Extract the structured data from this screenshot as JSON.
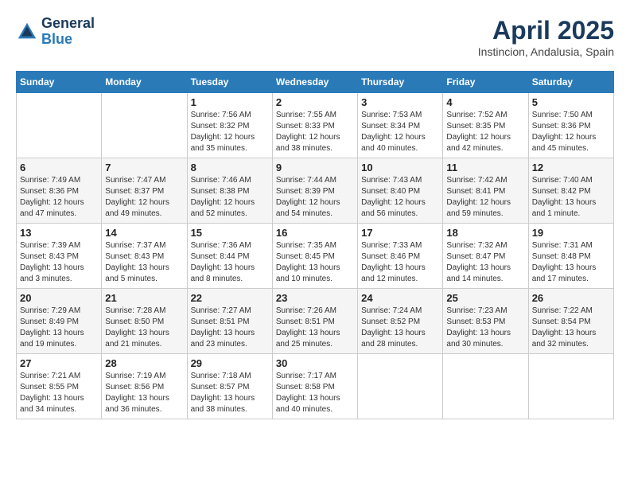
{
  "header": {
    "logo_line1": "General",
    "logo_line2": "Blue",
    "month_year": "April 2025",
    "location": "Instincion, Andalusia, Spain"
  },
  "days_of_week": [
    "Sunday",
    "Monday",
    "Tuesday",
    "Wednesday",
    "Thursday",
    "Friday",
    "Saturday"
  ],
  "weeks": [
    [
      {
        "day": null
      },
      {
        "day": null
      },
      {
        "day": "1",
        "sunrise": "Sunrise: 7:56 AM",
        "sunset": "Sunset: 8:32 PM",
        "daylight": "Daylight: 12 hours and 35 minutes."
      },
      {
        "day": "2",
        "sunrise": "Sunrise: 7:55 AM",
        "sunset": "Sunset: 8:33 PM",
        "daylight": "Daylight: 12 hours and 38 minutes."
      },
      {
        "day": "3",
        "sunrise": "Sunrise: 7:53 AM",
        "sunset": "Sunset: 8:34 PM",
        "daylight": "Daylight: 12 hours and 40 minutes."
      },
      {
        "day": "4",
        "sunrise": "Sunrise: 7:52 AM",
        "sunset": "Sunset: 8:35 PM",
        "daylight": "Daylight: 12 hours and 42 minutes."
      },
      {
        "day": "5",
        "sunrise": "Sunrise: 7:50 AM",
        "sunset": "Sunset: 8:36 PM",
        "daylight": "Daylight: 12 hours and 45 minutes."
      }
    ],
    [
      {
        "day": "6",
        "sunrise": "Sunrise: 7:49 AM",
        "sunset": "Sunset: 8:36 PM",
        "daylight": "Daylight: 12 hours and 47 minutes."
      },
      {
        "day": "7",
        "sunrise": "Sunrise: 7:47 AM",
        "sunset": "Sunset: 8:37 PM",
        "daylight": "Daylight: 12 hours and 49 minutes."
      },
      {
        "day": "8",
        "sunrise": "Sunrise: 7:46 AM",
        "sunset": "Sunset: 8:38 PM",
        "daylight": "Daylight: 12 hours and 52 minutes."
      },
      {
        "day": "9",
        "sunrise": "Sunrise: 7:44 AM",
        "sunset": "Sunset: 8:39 PM",
        "daylight": "Daylight: 12 hours and 54 minutes."
      },
      {
        "day": "10",
        "sunrise": "Sunrise: 7:43 AM",
        "sunset": "Sunset: 8:40 PM",
        "daylight": "Daylight: 12 hours and 56 minutes."
      },
      {
        "day": "11",
        "sunrise": "Sunrise: 7:42 AM",
        "sunset": "Sunset: 8:41 PM",
        "daylight": "Daylight: 12 hours and 59 minutes."
      },
      {
        "day": "12",
        "sunrise": "Sunrise: 7:40 AM",
        "sunset": "Sunset: 8:42 PM",
        "daylight": "Daylight: 13 hours and 1 minute."
      }
    ],
    [
      {
        "day": "13",
        "sunrise": "Sunrise: 7:39 AM",
        "sunset": "Sunset: 8:43 PM",
        "daylight": "Daylight: 13 hours and 3 minutes."
      },
      {
        "day": "14",
        "sunrise": "Sunrise: 7:37 AM",
        "sunset": "Sunset: 8:43 PM",
        "daylight": "Daylight: 13 hours and 5 minutes."
      },
      {
        "day": "15",
        "sunrise": "Sunrise: 7:36 AM",
        "sunset": "Sunset: 8:44 PM",
        "daylight": "Daylight: 13 hours and 8 minutes."
      },
      {
        "day": "16",
        "sunrise": "Sunrise: 7:35 AM",
        "sunset": "Sunset: 8:45 PM",
        "daylight": "Daylight: 13 hours and 10 minutes."
      },
      {
        "day": "17",
        "sunrise": "Sunrise: 7:33 AM",
        "sunset": "Sunset: 8:46 PM",
        "daylight": "Daylight: 13 hours and 12 minutes."
      },
      {
        "day": "18",
        "sunrise": "Sunrise: 7:32 AM",
        "sunset": "Sunset: 8:47 PM",
        "daylight": "Daylight: 13 hours and 14 minutes."
      },
      {
        "day": "19",
        "sunrise": "Sunrise: 7:31 AM",
        "sunset": "Sunset: 8:48 PM",
        "daylight": "Daylight: 13 hours and 17 minutes."
      }
    ],
    [
      {
        "day": "20",
        "sunrise": "Sunrise: 7:29 AM",
        "sunset": "Sunset: 8:49 PM",
        "daylight": "Daylight: 13 hours and 19 minutes."
      },
      {
        "day": "21",
        "sunrise": "Sunrise: 7:28 AM",
        "sunset": "Sunset: 8:50 PM",
        "daylight": "Daylight: 13 hours and 21 minutes."
      },
      {
        "day": "22",
        "sunrise": "Sunrise: 7:27 AM",
        "sunset": "Sunset: 8:51 PM",
        "daylight": "Daylight: 13 hours and 23 minutes."
      },
      {
        "day": "23",
        "sunrise": "Sunrise: 7:26 AM",
        "sunset": "Sunset: 8:51 PM",
        "daylight": "Daylight: 13 hours and 25 minutes."
      },
      {
        "day": "24",
        "sunrise": "Sunrise: 7:24 AM",
        "sunset": "Sunset: 8:52 PM",
        "daylight": "Daylight: 13 hours and 28 minutes."
      },
      {
        "day": "25",
        "sunrise": "Sunrise: 7:23 AM",
        "sunset": "Sunset: 8:53 PM",
        "daylight": "Daylight: 13 hours and 30 minutes."
      },
      {
        "day": "26",
        "sunrise": "Sunrise: 7:22 AM",
        "sunset": "Sunset: 8:54 PM",
        "daylight": "Daylight: 13 hours and 32 minutes."
      }
    ],
    [
      {
        "day": "27",
        "sunrise": "Sunrise: 7:21 AM",
        "sunset": "Sunset: 8:55 PM",
        "daylight": "Daylight: 13 hours and 34 minutes."
      },
      {
        "day": "28",
        "sunrise": "Sunrise: 7:19 AM",
        "sunset": "Sunset: 8:56 PM",
        "daylight": "Daylight: 13 hours and 36 minutes."
      },
      {
        "day": "29",
        "sunrise": "Sunrise: 7:18 AM",
        "sunset": "Sunset: 8:57 PM",
        "daylight": "Daylight: 13 hours and 38 minutes."
      },
      {
        "day": "30",
        "sunrise": "Sunrise: 7:17 AM",
        "sunset": "Sunset: 8:58 PM",
        "daylight": "Daylight: 13 hours and 40 minutes."
      },
      {
        "day": null
      },
      {
        "day": null
      },
      {
        "day": null
      }
    ]
  ]
}
